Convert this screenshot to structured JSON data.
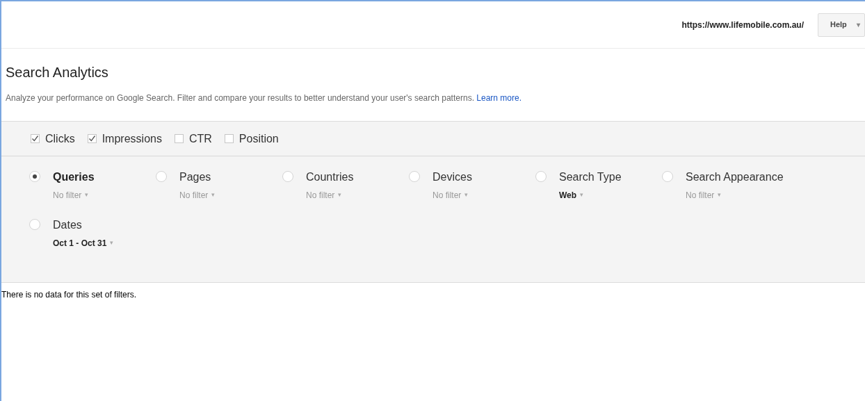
{
  "header": {
    "site_url": "https://www.lifemobile.com.au/",
    "help_button": "Help",
    "help_caret": "▾"
  },
  "title": "Search Analytics",
  "description": {
    "text": "Analyze your performance on Google Search. Filter and compare your results to better understand your user's search patterns.",
    "link": "Learn more."
  },
  "metrics": [
    {
      "label": "Clicks",
      "checked": true
    },
    {
      "label": "Impressions",
      "checked": true
    },
    {
      "label": "CTR",
      "checked": false
    },
    {
      "label": "Position",
      "checked": false
    }
  ],
  "groupings": [
    {
      "label": "Queries",
      "selected": true,
      "filter": "No filter",
      "filtered": false
    },
    {
      "label": "Pages",
      "selected": false,
      "filter": "No filter",
      "filtered": false
    },
    {
      "label": "Countries",
      "selected": false,
      "filter": "No filter",
      "filtered": false
    },
    {
      "label": "Devices",
      "selected": false,
      "filter": "No filter",
      "filtered": false
    },
    {
      "label": "Search Type",
      "selected": false,
      "filter": "Web",
      "filtered": true
    },
    {
      "label": "Search Appearance",
      "selected": false,
      "filter": "No filter",
      "filtered": false
    },
    {
      "label": "Dates",
      "selected": false,
      "filter": "Oct 1 - Oct 31",
      "filtered": true
    }
  ],
  "filter_caret": "▾",
  "empty_message": "There is no data for this set of filters."
}
